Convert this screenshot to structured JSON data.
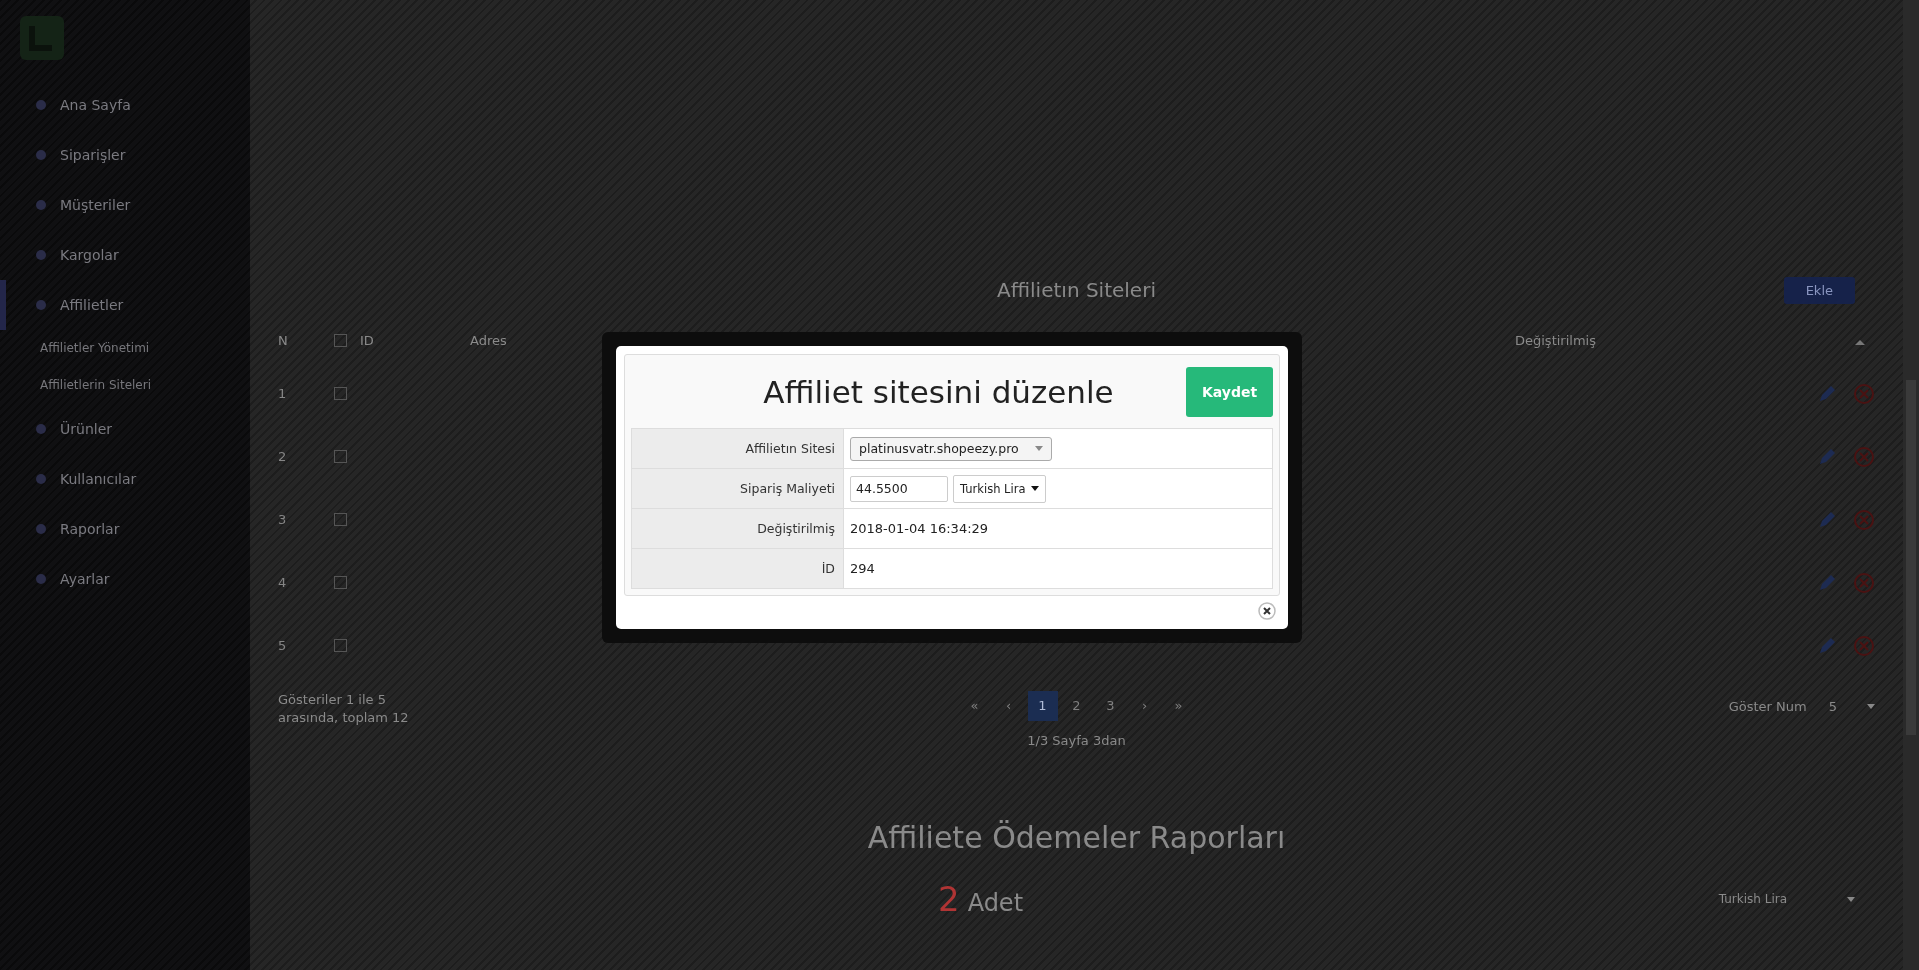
{
  "sidebar": {
    "items": [
      {
        "label": "Ana Sayfa",
        "selected": false
      },
      {
        "label": "Siparişler",
        "selected": false
      },
      {
        "label": "Müşteriler",
        "selected": false
      },
      {
        "label": "Kargolar",
        "selected": false
      },
      {
        "label": "Affilietler",
        "selected": true,
        "children": [
          {
            "label": "Affilietler Yönetimi",
            "selected": false
          },
          {
            "label": "Affilietlerin Siteleri",
            "selected": false
          }
        ]
      },
      {
        "label": "Ürünler",
        "selected": false
      },
      {
        "label": "Kullanıcılar",
        "selected": false
      },
      {
        "label": "Raporlar",
        "selected": false
      },
      {
        "label": "Ayarlar",
        "selected": false
      }
    ]
  },
  "sites": {
    "title": "Affilietın Siteleri",
    "add_button": "Ekle",
    "columns": [
      "N",
      "ID",
      "Adres",
      "Değiştirilmiş"
    ],
    "all_checked": false,
    "rows": [
      {
        "number": "1",
        "checked": false
      },
      {
        "number": "2",
        "checked": false
      },
      {
        "number": "3",
        "checked": false
      },
      {
        "number": "4",
        "checked": false
      },
      {
        "number": "5",
        "checked": false
      }
    ],
    "summary": "Gösteriler 1 ile 5 arasında, toplam 12",
    "pages": [
      {
        "label": "«",
        "selected": false
      },
      {
        "label": "‹",
        "selected": false
      },
      {
        "label": "1",
        "selected": true
      },
      {
        "label": "2",
        "selected": false
      },
      {
        "label": "3",
        "selected": false
      },
      {
        "label": "›",
        "selected": false
      },
      {
        "label": "»",
        "selected": false
      }
    ],
    "page_info": "1/3 Sayfa 3dan",
    "per_page_label": "Göster Num",
    "per_page": "5"
  },
  "payments": {
    "title": "Affiliete Ödemeler Raporları",
    "count": "2",
    "count_label": "Adet",
    "currency": "Turkish Lira"
  },
  "modal": {
    "title": "Affiliet sitesini düzenle",
    "save_button": "Kaydet",
    "fields": [
      {
        "kind": "select",
        "label": "Affilietın Sitesi",
        "value": "platinusvatr.shopeezy.pro"
      },
      {
        "kind": "money",
        "label": "Sipariş Maliyeti",
        "value": "44.5500",
        "currency": "Turkish Lira"
      },
      {
        "kind": "text",
        "label": "Değiştirilmiş",
        "value": "2018-01-04 16:34:29"
      },
      {
        "kind": "text",
        "label": "İD",
        "value": "294"
      }
    ]
  }
}
